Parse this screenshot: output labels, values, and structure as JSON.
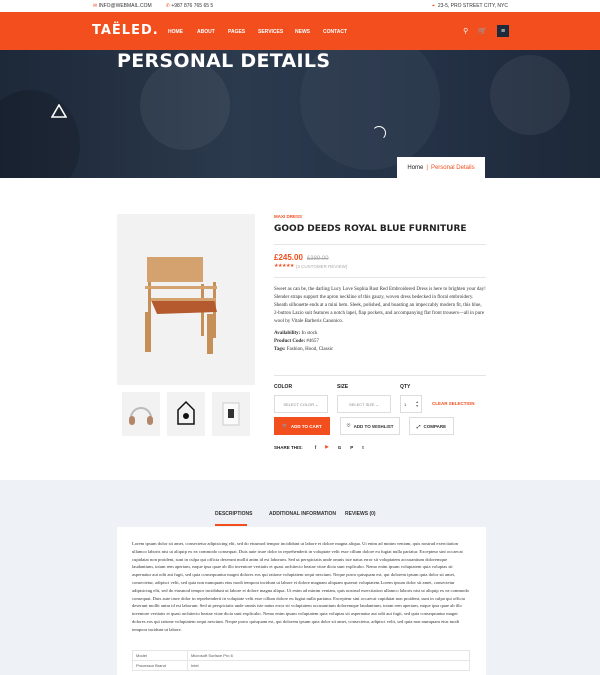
{
  "topbar": {
    "email": "INFO@WEBMAIL.COM",
    "phone": "+987 876 765 65 5",
    "address": "23-5, PRO STREET CITY, NYC"
  },
  "header": {
    "logo": "TAËLED.",
    "nav": [
      "HOME",
      "ABOUT",
      "PAGES",
      "SERVICES",
      "NEWS",
      "CONTACT"
    ]
  },
  "hero": {
    "title": "PERSONAL DETAILS",
    "breadcrumb_home": "Home",
    "breadcrumb_sep": "|",
    "breadcrumb_current": "Personal Details"
  },
  "product": {
    "category": "MAXI DRESS",
    "title": "GOOD DEEDS ROYAL BLUE FURNITURE",
    "price": "£245.00",
    "old_price": "£389.00",
    "rating": 5,
    "review_text": "(3 CUSTOMER REVIEW)",
    "description": "Sweet as can be, the darling Lucy Love Sophia Rust Red Embroidered Dress is here to brighten your day! Slender straps support the apron neckline of this gauzy, woven dress bedecked in floral embroidery. Sheath silhouette ends at a mini hem. Sleek, polished, and boasting an impeccably modern fit, this blue, 2-button Lazio suit features a notch lapel, flap pockets, and accompanying flat front trousers—all in pure wool by Vitale Barberis Canonico.",
    "availability_label": "Availability:",
    "availability": "In stock",
    "code_label": "Product Code:",
    "code": "#4657",
    "tags_label": "Tags:",
    "tags": "Fashion, Hood, Classic",
    "color_label": "COLOR",
    "color_placeholder": "SELECT COLOR",
    "size_label": "SIZE",
    "size_placeholder": "SELECT SIZE",
    "qty_label": "QTY",
    "qty": "1",
    "clear": "CLEAR SELECTION",
    "add_to_cart": "ADD TO CART",
    "wishlist": "ADD TO WISHLIST",
    "compare": "COMPARE",
    "share_label": "SHARE THIS:"
  },
  "tabs": {
    "items": [
      "DESCRIPTIONS",
      "ADDITIONAL INFORMATION",
      "REVIEWS (0)"
    ],
    "active": 0,
    "text": "Lorem ipsum dolor sit amet, consectetur adipisicing elit, sed do eiusmod tempor incididunt ut labore et dolore magna aliqua. Ut enim ad minim veniam, quis nostrud exercitation ullamco laboris nisi ut aliquip ex ea commodo consequat. Duis aute irure dolor in reprehenderit in voluptate velit esse cillum dolore eu fugiat nulla pariatur. Excepteur sint occaecat cupidatat non proident, sunt in culpa qui officia deserunt mollit anim id est laborum. Sed ut perspiciatis unde omnis iste natus error sit voluptatem accusantium doloremque laudantium, totam rem aperiam, eaque ipsa quae ab illo inventore veritatis et quasi architecto beatae vitae dicta sunt explicabo. Nemo enim ipsam voluptatem quia voluptas sit aspernatur aut odit aut fugit, sed quia consequuntur magni dolores eos qui ratione voluptatem sequi nesciunt. Neque porro quisquam est, qui dolorem ipsum quia dolor sit amet, consectetur, adipisci velit, sed quia non numquam eius modi tempora incidunt ut labore et dolore magnam aliquam quaerat voluptatem.Lorem ipsum dolor sit amet, consectetur adipisicing elit, sed do eiusmod tempor incididunt ut labore et dolore magna aliqua. Ut enim ad minim veniam, quis nostrud exercitation ullamco laboris nisi ut aliquip ex ea commodo consequat. Duis aute irure dolor in reprehenderit in voluptate velit esse cillum dolore eu fugiat nulla pariatur. Excepteur sint occaecat cupidatat non proident, sunt in culpa qui officia deserunt mollit anim id est laborum. Sed ut perspiciatis unde omnis iste natus error sit voluptatem accusantium doloremque laudantium, totam rem aperiam, eaque ipsa quae ab illo inventore veritatis et quasi architecto beatae vitae dicta sunt explicabo. Nemo enim ipsam voluptatem quia voluptas sit aspernatur aut odit aut fugit, sed quia consequuntur magni dolores eos qui ratione voluptatem sequi nesciunt. Neque porro quisquam est, qui dolorem ipsum quia dolor sit amet, consectetur, adipisci velit, sed quia non numquam eius modi tempora incidunt ut labore.",
    "spec": [
      [
        "Model",
        "Microsoft Surface Pro 6"
      ],
      [
        "Processor Brand",
        "Intel"
      ]
    ]
  },
  "colors": {
    "accent": "#f24e1e",
    "dark": "#1c2a3c"
  }
}
